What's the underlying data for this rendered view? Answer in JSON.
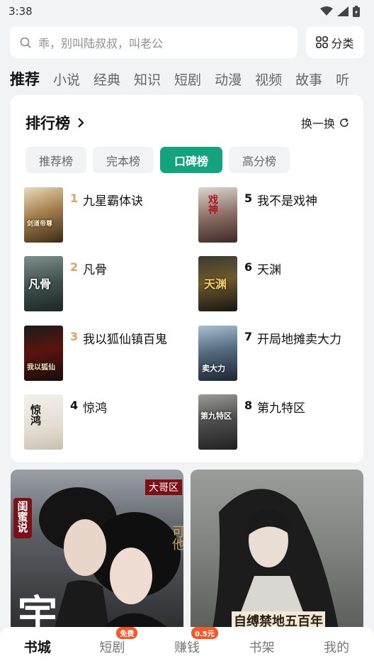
{
  "status_bar": {
    "time": "3:38"
  },
  "search": {
    "placeholder": "乖，别叫陆叔叔，叫老公",
    "category_label": "分类"
  },
  "tabs": [
    "推荐",
    "小说",
    "经典",
    "知识",
    "短剧",
    "动漫",
    "视频",
    "故事",
    "听"
  ],
  "ranking": {
    "title": "排行榜",
    "refresh_label": "换一换",
    "tabs": [
      "推荐榜",
      "完本榜",
      "口碑榜",
      "高分榜"
    ],
    "active_tab": "口碑榜",
    "books": [
      {
        "rank": "1",
        "title": "九星霸体诀"
      },
      {
        "rank": "2",
        "title": "凡骨"
      },
      {
        "rank": "3",
        "title": "我以狐仙镇百鬼"
      },
      {
        "rank": "4",
        "title": "惊鸿"
      },
      {
        "rank": "5",
        "title": "我不是戏神"
      },
      {
        "rank": "6",
        "title": "天渊"
      },
      {
        "rank": "7",
        "title": "开局地摊卖大力"
      },
      {
        "rank": "8",
        "title": "第九特区"
      }
    ],
    "covers": [
      "剑道帝尊",
      "凡骨",
      "我以狐仙",
      "惊鸿",
      "戏神",
      "天渊",
      "卖大力",
      "第九特区"
    ]
  },
  "banners": {
    "left": {
      "side_text": "闺蜜说",
      "tag": "大哥区",
      "big_char": "宇",
      "right_text": "可他"
    },
    "right": {
      "title": "自缚禁地五百年"
    }
  },
  "bottom_nav": {
    "items": [
      "书城",
      "短剧",
      "赚钱",
      "书架",
      "我的"
    ],
    "badges": {
      "short_drama": "免费",
      "earn": "0.5元"
    }
  },
  "colors": {
    "accent": "#14a37f",
    "top_rank": "#d9a46a",
    "badge": "#f25a29"
  }
}
